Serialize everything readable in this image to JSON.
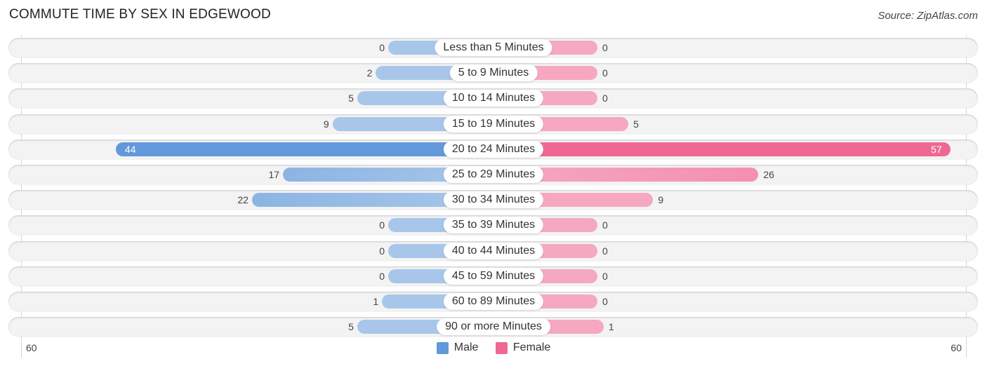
{
  "title": "COMMUTE TIME BY SEX IN EDGEWOOD",
  "source": "Source: ZipAtlas.com",
  "colors": {
    "male": "#6199da",
    "male_light": "#a8c6ea",
    "female": "#ef6892",
    "female_light": "#f5a8c0"
  },
  "axis": {
    "left_tick": "60",
    "right_tick": "60"
  },
  "legend": [
    {
      "label": "Male",
      "color": "#6199da"
    },
    {
      "label": "Female",
      "color": "#ef6892"
    }
  ],
  "chart_data": {
    "type": "bar",
    "orientation": "horizontal-diverging",
    "title": "COMMUTE TIME BY SEX IN EDGEWOOD",
    "categories": [
      "Less than 5 Minutes",
      "5 to 9 Minutes",
      "10 to 14 Minutes",
      "15 to 19 Minutes",
      "20 to 24 Minutes",
      "25 to 29 Minutes",
      "30 to 34 Minutes",
      "35 to 39 Minutes",
      "40 to 44 Minutes",
      "45 to 59 Minutes",
      "60 to 89 Minutes",
      "90 or more Minutes"
    ],
    "series": [
      {
        "name": "Male",
        "values": [
          0,
          2,
          5,
          9,
          44,
          17,
          22,
          0,
          0,
          0,
          1,
          5
        ]
      },
      {
        "name": "Female",
        "values": [
          0,
          0,
          0,
          5,
          57,
          26,
          9,
          0,
          0,
          0,
          0,
          1
        ]
      }
    ],
    "xlim": [
      -60,
      60
    ],
    "xtick_labels": [
      "60",
      "60"
    ],
    "legend_position": "bottom-center",
    "grid": false
  }
}
